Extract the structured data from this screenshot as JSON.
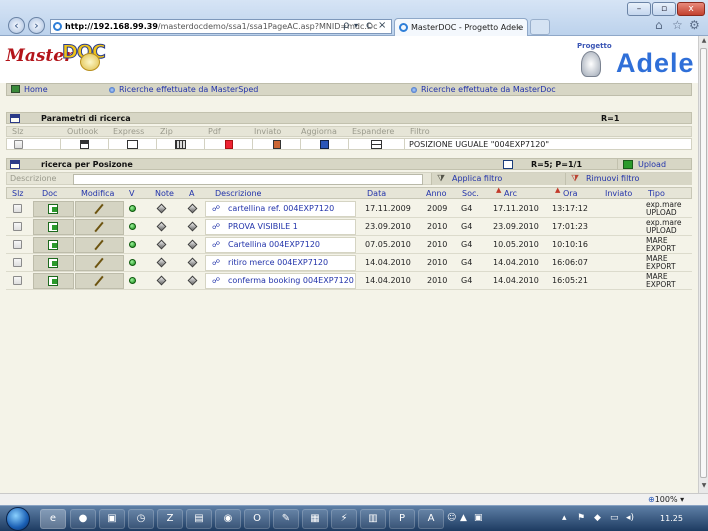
{
  "browser": {
    "url_host": "http://192.168.99.39",
    "url_rest": "/masterdocdemo/ssa1/ssa1PageAC.asp?MNID=mdc.Dc",
    "tab_title": "MasterDOC - Progetto Adele",
    "tab_close": "×",
    "addr_search": "ρ",
    "addr_refresh": "c",
    "addr_close": "×",
    "window_min": "–",
    "window_max": "▫",
    "window_close": "x"
  },
  "banner": {
    "logo_master": "Master",
    "logo_doc": "DOC",
    "logo_progetto": "Progetto",
    "logo_adele": "Adele"
  },
  "menu": {
    "home": "Home",
    "ricerche_mastersped": "Ricerche effettuate da MasterSped",
    "ricerche_masterdoc": "Ricerche effettuate da MasterDoc"
  },
  "params": {
    "title": "Parametri di ricerca",
    "r": "R=1",
    "headers": [
      "Slz",
      "Outlook",
      "Express",
      "Zip",
      "Pdf",
      "Inviato",
      "Aggiorna",
      "Espandere",
      "Filtro"
    ],
    "filter_value": "POSIZIONE UGUALE \"004EXP7120\""
  },
  "search": {
    "title": "ricerca per Posizone",
    "counts": "R=5; P=1/1",
    "upload": "Upload",
    "desc_label": "Descrizione",
    "apply": "Applica filtro",
    "remove": "Rimuovi filtro"
  },
  "grid": {
    "headers": [
      "Slz",
      "Doc",
      "Modifica",
      "V",
      "Note",
      "A",
      "Descrizione",
      "Data",
      "Anno",
      "Soc.",
      "Arc",
      "Ora",
      "Inviato",
      "Tipo"
    ],
    "rows": [
      {
        "desc": "cartellina ref. 004EXP7120",
        "data": "17.11.2009",
        "anno": "2009",
        "soc": "G4",
        "arc": "17.11.2010",
        "ora": "13:17:12",
        "inviato": "",
        "tipo1": "exp.mare",
        "tipo2": "UPLOAD"
      },
      {
        "desc": "PROVA VISIBILE 1",
        "data": "23.09.2010",
        "anno": "2010",
        "soc": "G4",
        "arc": "23.09.2010",
        "ora": "17:01:23",
        "inviato": "",
        "tipo1": "exp.mare",
        "tipo2": "UPLOAD"
      },
      {
        "desc": "Cartellina 004EXP7120",
        "data": "07.05.2010",
        "anno": "2010",
        "soc": "G4",
        "arc": "10.05.2010",
        "ora": "10:10:16",
        "inviato": "",
        "tipo1": "MARE",
        "tipo2": "EXPORT"
      },
      {
        "desc": "ritiro merce 004EXP7120",
        "data": "14.04.2010",
        "anno": "2010",
        "soc": "G4",
        "arc": "14.04.2010",
        "ora": "16:06:07",
        "inviato": "",
        "tipo1": "MARE",
        "tipo2": "EXPORT"
      },
      {
        "desc": "conferma booking 004EXP7120",
        "data": "14.04.2010",
        "anno": "2010",
        "soc": "G4",
        "arc": "14.04.2010",
        "ora": "16:05:21",
        "inviato": "",
        "tipo1": "MARE",
        "tipo2": "EXPORT"
      }
    ]
  },
  "status": {
    "zoom": "100%"
  },
  "taskbar": {
    "clock": "11.25"
  }
}
